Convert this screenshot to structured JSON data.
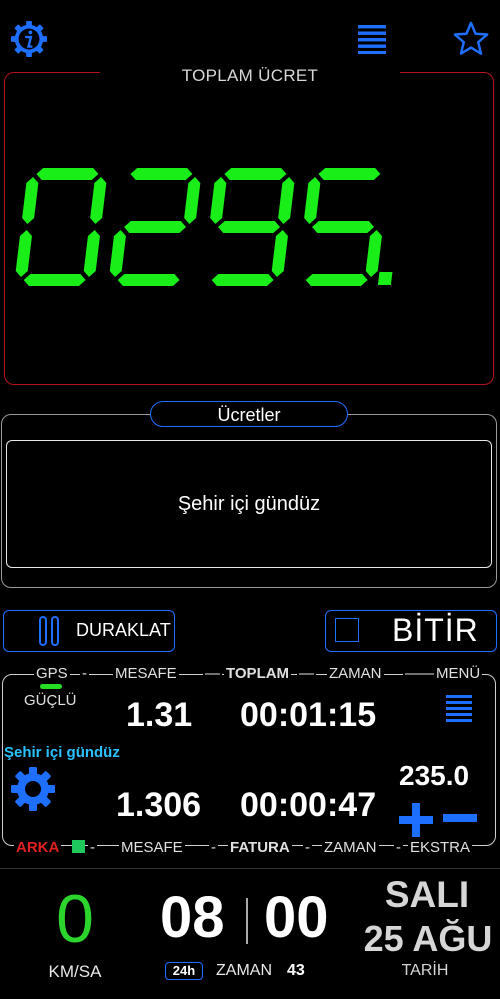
{
  "colors": {
    "accent": "#1f6fff",
    "digital_green": "#19ee19",
    "panel_red": "#b3141c",
    "night_tariff": "#2bc3ff",
    "arka_red": "#e02020"
  },
  "topbar": {
    "icons": [
      "info-icon",
      "menu-icon",
      "star-icon"
    ]
  },
  "fare": {
    "label": "TOPLAM ÜCRET",
    "value": "0295.1"
  },
  "tariffs": {
    "title": "Ücretler",
    "selected": "Şehir içi gündüz"
  },
  "actions": {
    "pause_label": "DURAKLAT",
    "finish_label": "BİTİR"
  },
  "info": {
    "top_headers": {
      "gps": "GPS",
      "distance": "MESAFE",
      "total": "TOPLAM",
      "time": "ZAMAN",
      "menu": "MENÜ"
    },
    "gps_strength": "GÜÇLÜ",
    "total_distance": "1.31",
    "total_time": "00:01:15",
    "tariff_name": "Şehir içi gündüz",
    "invoice_distance": "1.306",
    "invoice_time": "00:00:47",
    "extra_amount": "235.0",
    "bottom_headers": {
      "arka": "ARKA",
      "distance": "MESAFE",
      "invoice": "FATURA",
      "time": "ZAMAN",
      "extra": "EKSTRA"
    }
  },
  "speed": {
    "value": "0",
    "unit": "KM/SA"
  },
  "clock": {
    "hours": "08",
    "minutes": "00",
    "seconds": "43",
    "format_badge": "24h",
    "label": "ZAMAN"
  },
  "date": {
    "day": "SALI",
    "date": "25 AĞU",
    "label": "TARİH"
  }
}
